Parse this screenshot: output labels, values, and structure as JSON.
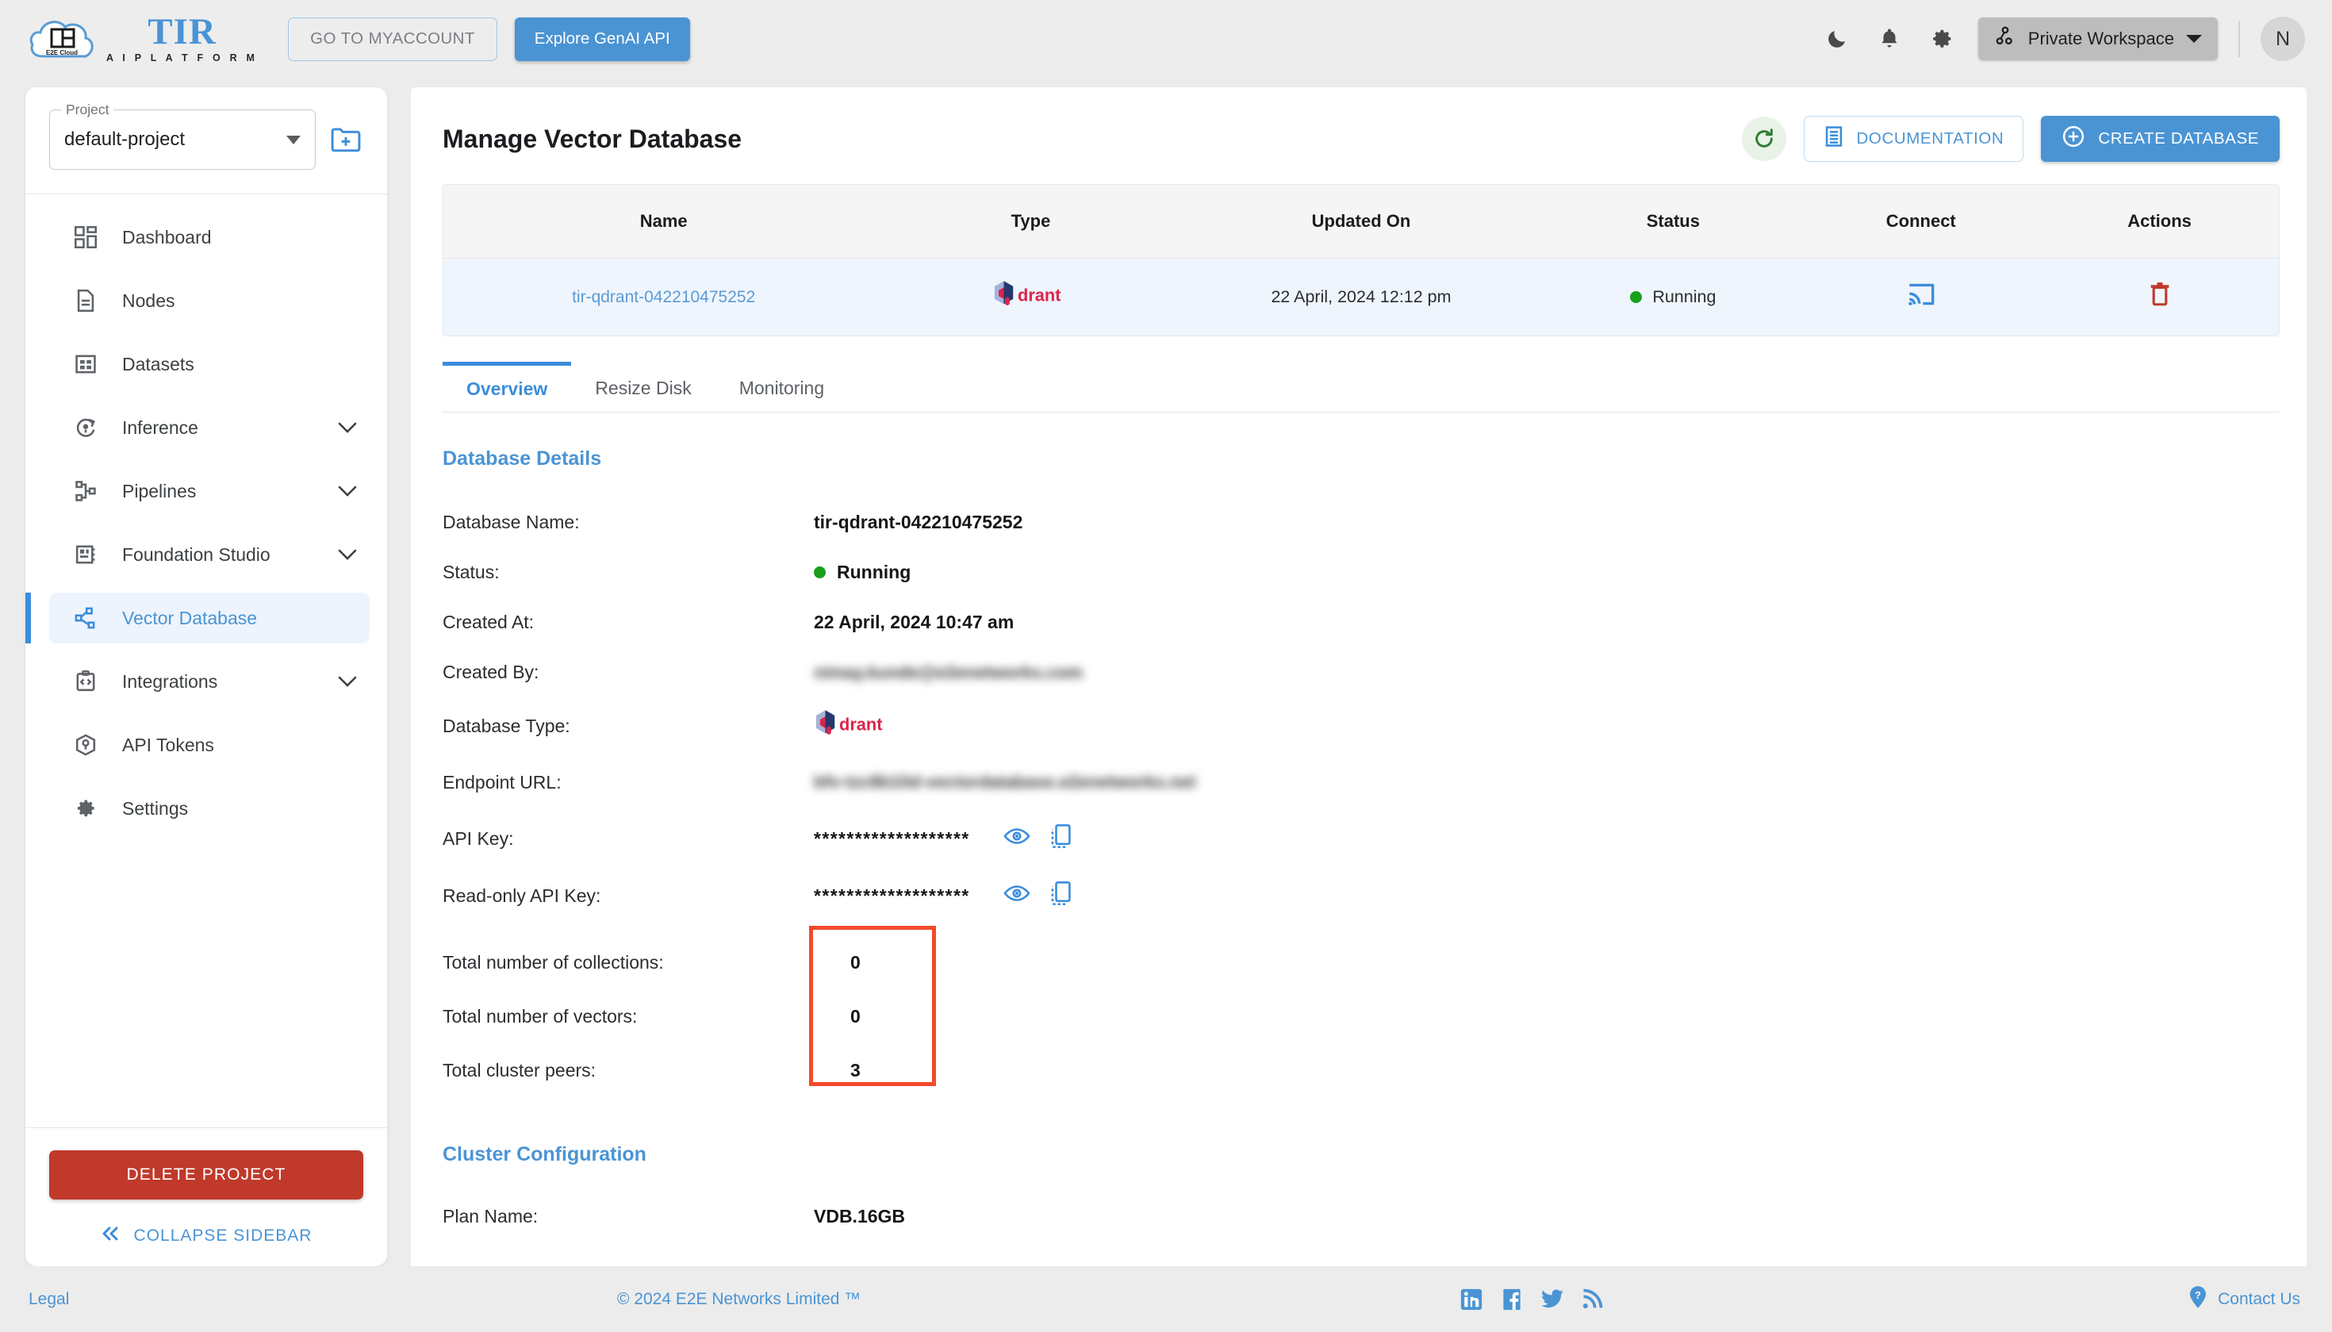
{
  "topbar": {
    "logo_title": "TIR",
    "logo_subtitle": "A I   P L A T F O R M",
    "logo_badge": "E2E Cloud",
    "myaccount_label": "GO TO MYACCOUNT",
    "genai_label": "Explore GenAI API",
    "workspace_label": "Private Workspace",
    "avatar_initial": "N",
    "icons": [
      "moon-icon",
      "bell-icon",
      "gear-icon"
    ]
  },
  "sidebar": {
    "project_legend": "Project",
    "project_value": "default-project",
    "items": [
      {
        "label": "Dashboard",
        "icon": "dashboard-icon",
        "expandable": false,
        "active": false
      },
      {
        "label": "Nodes",
        "icon": "document-icon",
        "expandable": false,
        "active": false
      },
      {
        "label": "Datasets",
        "icon": "table-icon",
        "expandable": false,
        "active": false
      },
      {
        "label": "Inference",
        "icon": "inference-icon",
        "expandable": true,
        "active": false
      },
      {
        "label": "Pipelines",
        "icon": "pipelines-icon",
        "expandable": true,
        "active": false
      },
      {
        "label": "Foundation Studio",
        "icon": "studio-icon",
        "expandable": true,
        "active": false
      },
      {
        "label": "Vector Database",
        "icon": "vector-db-icon",
        "expandable": false,
        "active": true
      },
      {
        "label": "Integrations",
        "icon": "integrations-icon",
        "expandable": true,
        "active": false
      },
      {
        "label": "API Tokens",
        "icon": "token-icon",
        "expandable": false,
        "active": false
      },
      {
        "label": "Settings",
        "icon": "settings-gear-icon",
        "expandable": false,
        "active": false
      }
    ],
    "delete_project_label": "DELETE PROJECT",
    "collapse_label": "COLLAPSE SIDEBAR"
  },
  "main": {
    "page_title": "Manage Vector Database",
    "documentation_label": "DOCUMENTATION",
    "create_database_label": "CREATE DATABASE",
    "refresh_icon": "refresh-icon",
    "table": {
      "columns": [
        "Name",
        "Type",
        "Updated On",
        "Status",
        "Connect",
        "Actions"
      ],
      "rows": [
        {
          "name": "tir-qdrant-042210475252",
          "type": "qdrant",
          "updated_on": "22 April, 2024 12:12 pm",
          "status": "Running",
          "status_color": "#18a01c",
          "connect_icon": "cast-connect-icon",
          "action_icon": "trash-icon"
        }
      ]
    },
    "tabs": [
      {
        "label": "Overview",
        "active": true
      },
      {
        "label": "Resize Disk",
        "active": false
      },
      {
        "label": "Monitoring",
        "active": false
      }
    ],
    "database_details": {
      "heading": "Database Details",
      "fields": [
        {
          "label": "Database Name:",
          "value": "tir-qdrant-042210475252",
          "kind": "text"
        },
        {
          "label": "Status:",
          "value": "Running",
          "kind": "status"
        },
        {
          "label": "Created At:",
          "value": "22 April, 2024 10:47 am",
          "kind": "text"
        },
        {
          "label": "Created By:",
          "value": "nimay.kunde@e2enetworks.com",
          "kind": "blurred"
        },
        {
          "label": "Database Type:",
          "value": "qdrant",
          "kind": "logo"
        },
        {
          "label": "Endpoint URL:",
          "value": "bfv-tzc8b10d-vectordatabase.e2enetworks.net",
          "kind": "blurred"
        },
        {
          "label": "API Key:",
          "value": "*******************",
          "kind": "secret"
        },
        {
          "label": "Read-only API Key:",
          "value": "*******************",
          "kind": "secret"
        }
      ],
      "stats": [
        {
          "label": "Total number of collections:",
          "value": "0"
        },
        {
          "label": "Total number of vectors:",
          "value": "0"
        },
        {
          "label": "Total cluster peers:",
          "value": "3"
        }
      ],
      "highlight_color": "#f4492a"
    },
    "cluster_configuration": {
      "heading": "Cluster Configuration",
      "fields": [
        {
          "label": "Plan Name:",
          "value": "VDB.16GB"
        }
      ]
    }
  },
  "footer": {
    "legal": "Legal",
    "copyright": "© 2024 E2E Networks Limited ™",
    "contact": "Contact Us",
    "socials": [
      "linkedin-icon",
      "facebook-icon",
      "twitter-icon",
      "rss-icon"
    ]
  },
  "colors": {
    "accent": "#4a94d4",
    "danger": "#c0392b",
    "success": "#18a01c",
    "highlight": "#f4492a"
  }
}
